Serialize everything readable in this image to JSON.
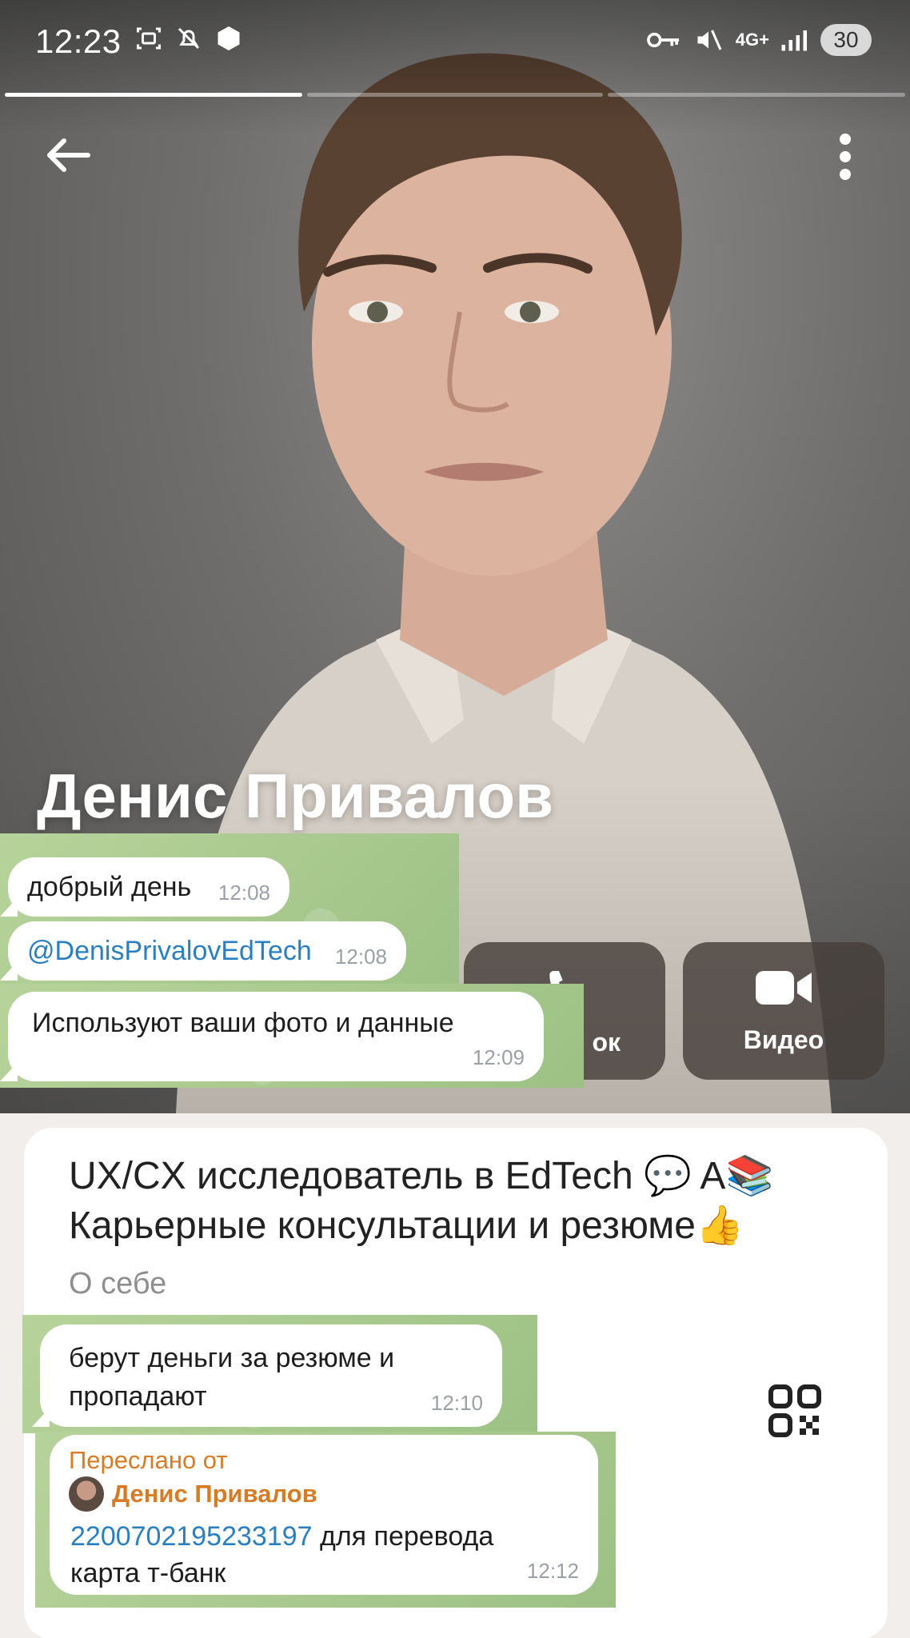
{
  "status_bar": {
    "time": "12:23",
    "network": "4G+",
    "battery": "30"
  },
  "profile": {
    "name": "Денис Привалов",
    "actions": {
      "call_label": "ок",
      "video_label": "Видео"
    },
    "bio_line1": "UX/CX исследователь в EdTech 💬 A📚",
    "bio_line2": "Карьерные консультации и резюме👍",
    "bio_caption": "О себе"
  },
  "chat": {
    "msg1": {
      "text": "добрый день",
      "time": "12:08"
    },
    "msg2": {
      "text": "@DenisPrivalovEdTech",
      "time": "12:08"
    },
    "msg3": {
      "text": "Используют ваши фото и данные",
      "time": "12:09"
    },
    "msg4": {
      "line1": "берут деньги за резюме и",
      "line2": "пропадают",
      "time": "12:10"
    },
    "msg5": {
      "forwarded_label": "Переслано от",
      "forwarded_name": "Денис Привалов",
      "card_number": "2200702195233197",
      "text_after": " для перевода",
      "line2": "карта т-банк",
      "time": "12:12"
    }
  },
  "colors": {
    "chat_background": "#a9c98f",
    "link": "#2a7fc0",
    "forward_accent": "#d77b25"
  },
  "icons": [
    "back-arrow-icon",
    "more-vert-icon",
    "video-icon",
    "qr-code-icon",
    "key-icon",
    "mute-icon",
    "signal-icon"
  ]
}
